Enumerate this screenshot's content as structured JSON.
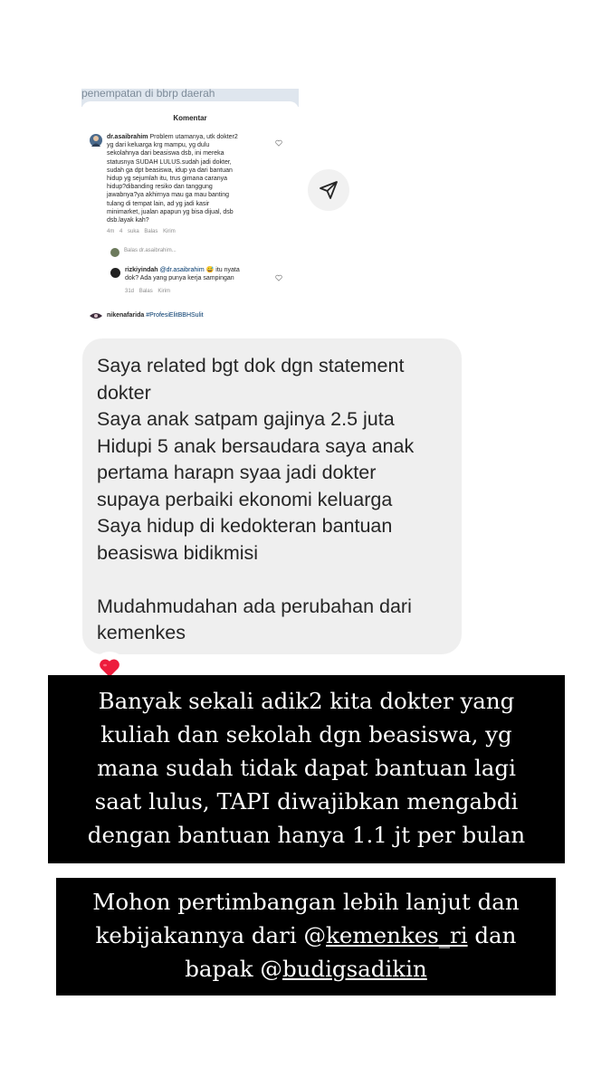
{
  "shot": {
    "peek_text": "penempatan di bbrp daerah",
    "title": "Komentar",
    "comment1": {
      "username": "dr.asaibrahim",
      "text": "Problem utamanya, utk dokter2 yg dari keluarga krg mampu, yg dulu sekolahnya dari beasiswa dsb, ini mereka statusnya SUDAH LULUS.sudah jadi dokter, sudah ga dpt beasiswa, idup ya dari bantuan hidup yg sejumlah itu, trus gimana caranya hidup?dibanding resiko dan tanggung jawabnya?ya akhirnya mau ga mau banting tulang di tempat lain, ad yg jadi kasir minimarket, jualan apapun yg bisa dijual, dsb dsb.layak kah?",
      "lines": [
        "Problem utamanya, utk dokter2",
        "yg dari keluarga krg mampu, yg dulu",
        "sekolahnya dari beasiswa dsb, ini mereka",
        "statusnya SUDAH LULUS.sudah jadi dokter,",
        "sudah ga dpt beasiswa, idup ya dari bantuan",
        "hidup yg sejumlah itu, trus gimana caranya",
        "hidup?dibanding resiko dan tanggung",
        "jawabnya?ya akhirnya mau ga mau banting",
        "tulang di tempat lain, ad yg jadi kasir",
        "minimarket, jualan apapun yg bisa dijual, dsb",
        "dsb.layak kah?"
      ],
      "time": "4m",
      "likes": "4 suka",
      "reply": "Balas",
      "send": "Kirim"
    },
    "reply_to": "Balas dr.asaibrahim...",
    "comment2": {
      "username": "rizkiyindah",
      "mention": "@dr.asaibrahim",
      "emoji": "😅",
      "text_after": "itu nyata",
      "line2": "dok? Ada yang punya kerja sampingan",
      "time": "31d",
      "reply": "Balas",
      "send": "Kirim"
    },
    "comment3": {
      "username": "nikenafarida",
      "hashtag": "#ProfesiElitBBHSulit"
    }
  },
  "send_icon": "paper-plane-icon",
  "bubble": {
    "text": "Saya related bgt dok dgn statement\ndokter\nSaya anak satpam gajinya 2.5 juta\nHidupi 5 anak bersaudara saya anak\npertama harapn syaa jadi dokter\nsupaya perbaiki ekonomi keluarga\nSaya hidup di kedokteran bantuan\nbeasiswa bidikmisi\n\nMudahmudahan ada perubahan dari\nkemenkes"
  },
  "reaction": "❤️",
  "caption1": {
    "lines": [
      "Banyak sekali adik2 kita dokter yang",
      "kuliah dan sekolah dgn beasiswa, yg",
      "mana sudah tidak dapat bantuan lagi",
      "saat lulus, TAPI diwajibkan mengabdi",
      "dengan bantuan hanya 1.1 jt per bulan"
    ]
  },
  "caption2": {
    "line1": "Mohon pertimbangan lebih lanjut dan",
    "line2_pre": "kebijakannya dari @",
    "line2_link": "kemenkes_ri",
    "line2_post": " dan",
    "line3_pre": "bapak @",
    "line3_link": "budigsadikin"
  },
  "colors": {
    "bubble": "#efefef",
    "caption_bg": "#000000",
    "caption_text": "#ffffff",
    "heart": "#ed4956"
  }
}
